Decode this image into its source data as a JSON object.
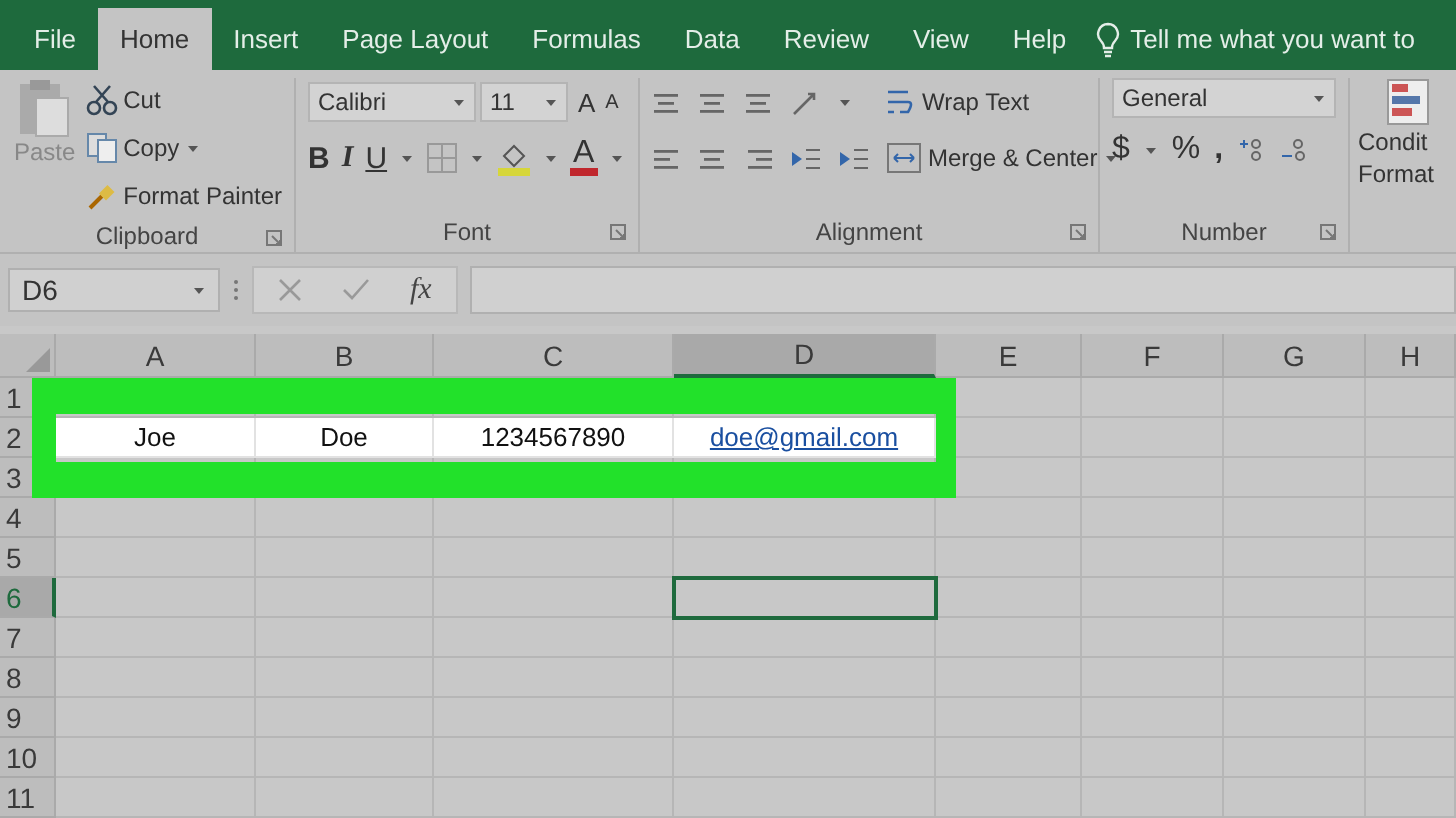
{
  "tabs": [
    {
      "label": "File",
      "selected": false
    },
    {
      "label": "Home",
      "selected": true
    },
    {
      "label": "Insert",
      "selected": false
    },
    {
      "label": "Page Layout",
      "selected": false
    },
    {
      "label": "Formulas",
      "selected": false
    },
    {
      "label": "Data",
      "selected": false
    },
    {
      "label": "Review",
      "selected": false
    },
    {
      "label": "View",
      "selected": false
    },
    {
      "label": "Help",
      "selected": false
    }
  ],
  "tell_me": "Tell me what you want to",
  "ribbon": {
    "clipboard": {
      "paste": "Paste",
      "cut": "Cut",
      "copy": "Copy",
      "format_painter": "Format Painter",
      "label": "Clipboard"
    },
    "font": {
      "font_name": "Calibri",
      "font_size": "11",
      "grow": "A",
      "shrink": "A",
      "bold": "B",
      "italic": "I",
      "underline": "U",
      "font_color": "A",
      "label": "Font"
    },
    "alignment": {
      "wrap_text": "Wrap Text",
      "merge_center": "Merge & Center",
      "label": "Alignment"
    },
    "number": {
      "format": "General",
      "currency": "$",
      "percent": "%",
      "comma": ",",
      "label": "Number"
    },
    "styles": {
      "line_1": "Condit",
      "line_2": "Format"
    }
  },
  "name_box": "D6",
  "fx": "fx",
  "columns": [
    {
      "label": "A",
      "selected": false
    },
    {
      "label": "B",
      "selected": false
    },
    {
      "label": "C",
      "selected": false
    },
    {
      "label": "D",
      "selected": true
    },
    {
      "label": "E",
      "selected": false
    },
    {
      "label": "F",
      "selected": false
    },
    {
      "label": "G",
      "selected": false
    },
    {
      "label": "H",
      "selected": false
    }
  ],
  "rows": [
    {
      "label": "1",
      "selected": false,
      "highlighted": false,
      "cells": []
    },
    {
      "label": "2",
      "selected": false,
      "highlighted": true,
      "cells": [
        {
          "kind": "text",
          "value": "Joe"
        },
        {
          "kind": "text",
          "value": "Doe"
        },
        {
          "kind": "text",
          "value": "1234567890"
        },
        {
          "kind": "link",
          "value": "doe@gmail.com"
        }
      ]
    },
    {
      "label": "3",
      "selected": false,
      "highlighted": false,
      "cells": []
    },
    {
      "label": "4",
      "selected": false,
      "highlighted": false,
      "cells": []
    },
    {
      "label": "5",
      "selected": false,
      "highlighted": false,
      "cells": []
    },
    {
      "label": "6",
      "selected": true,
      "highlighted": false,
      "cells": []
    },
    {
      "label": "7",
      "selected": false,
      "highlighted": false,
      "cells": []
    },
    {
      "label": "8",
      "selected": false,
      "highlighted": false,
      "cells": []
    },
    {
      "label": "9",
      "selected": false,
      "highlighted": false,
      "cells": []
    },
    {
      "label": "10",
      "selected": false,
      "highlighted": false,
      "cells": []
    },
    {
      "label": "11",
      "selected": false,
      "highlighted": false,
      "cells": []
    }
  ]
}
